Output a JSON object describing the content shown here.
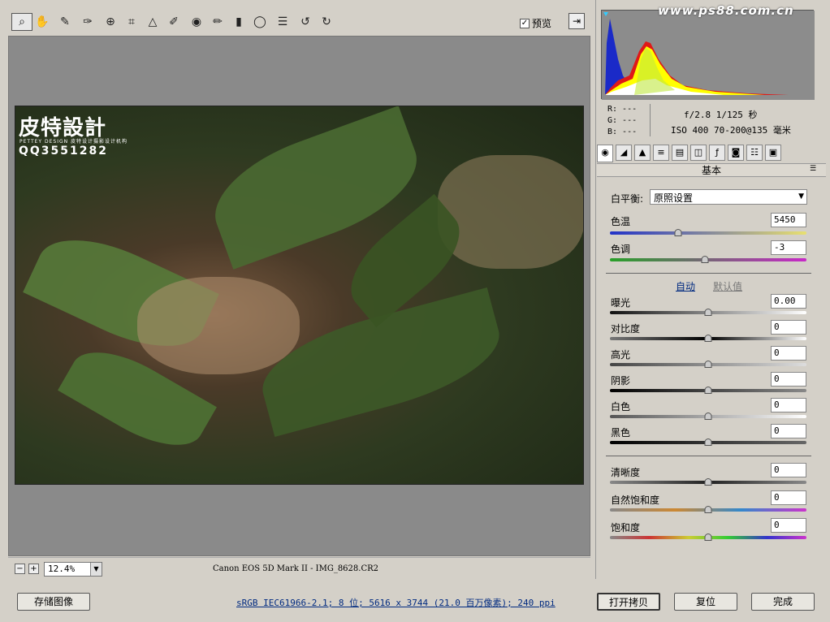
{
  "toolbar": {
    "preview_label": "预览",
    "preview_checked": "✓",
    "tools": [
      "zoom-tool",
      "hand-tool",
      "white-balance-tool",
      "color-sampler-tool",
      "target-adjustment-tool",
      "crop-tool",
      "straighten-tool",
      "spot-removal-tool",
      "red-eye-tool",
      "adjustment-brush-tool",
      "graduated-filter-tool",
      "radial-filter-tool",
      "preferences-tool",
      "rotate-left-tool",
      "rotate-right-tool"
    ]
  },
  "watermark": {
    "site": "www.ps88.com.cn",
    "brand": "皮特設計",
    "brand_sub": "PETTEY DESIGN 皮特设计摄影设计机构",
    "qq": "QQ3551282"
  },
  "status": {
    "zoom": "12.4%",
    "camera_file": "Canon EOS 5D Mark II -  IMG_8628.CR2",
    "zoom_minus": "−",
    "zoom_plus": "+"
  },
  "info": {
    "r": "R:  ---",
    "g": "G:  ---",
    "b": "B:  ---",
    "aperture_shutter": "f/2.8  1/125 秒",
    "iso_lens": "ISO 400  70-200@135 毫米"
  },
  "panel": {
    "title": "基本",
    "white_balance_label": "白平衡:",
    "white_balance_value": "原照设置",
    "auto_label": "自动",
    "default_label": "默认值"
  },
  "sliders": {
    "temp": {
      "label": "色温",
      "value": "5450"
    },
    "tint": {
      "label": "色调",
      "value": "-3"
    },
    "exposure": {
      "label": "曝光",
      "value": "0.00"
    },
    "contrast": {
      "label": "对比度",
      "value": "0"
    },
    "highlights": {
      "label": "高光",
      "value": "0"
    },
    "shadows": {
      "label": "阴影",
      "value": "0"
    },
    "whites": {
      "label": "白色",
      "value": "0"
    },
    "blacks": {
      "label": "黑色",
      "value": "0"
    },
    "clarity": {
      "label": "清晰度",
      "value": "0"
    },
    "vibrance": {
      "label": "自然饱和度",
      "value": "0"
    },
    "saturation": {
      "label": "饱和度",
      "value": "0"
    }
  },
  "footer": {
    "save_label": "存储图像",
    "workflow_link": "sRGB IEC61966-2.1; 8 位; 5616 x 3744 (21.0 百万像素); 240 ppi",
    "open_copy_label": "打开拷贝",
    "reset_label": "复位",
    "done_label": "完成"
  },
  "colors": {
    "accent": "#002a80",
    "panel_bg": "#d4d0c8",
    "canvas_bg": "#8a8a8a"
  }
}
